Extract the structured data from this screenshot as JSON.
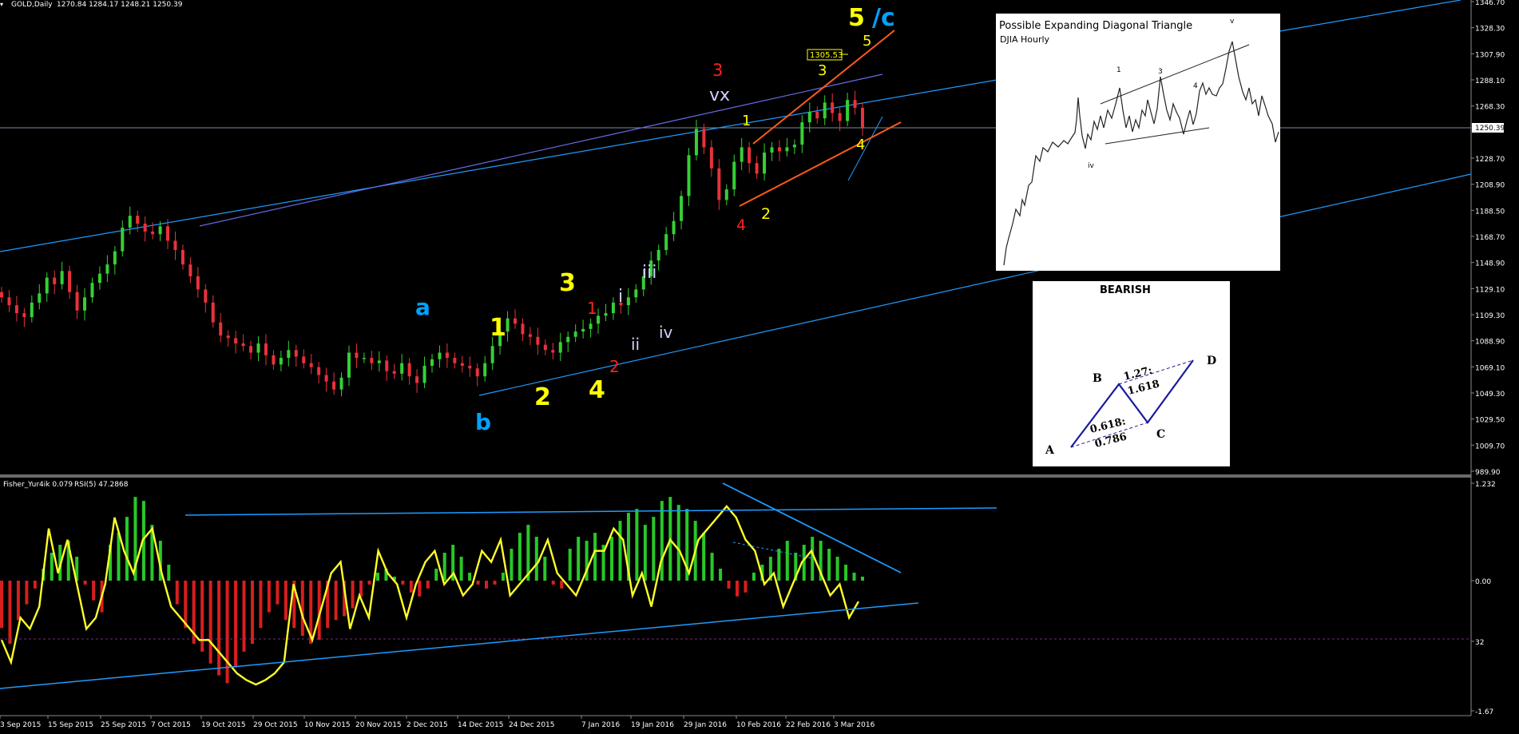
{
  "header": {
    "symbol": "GOLD,Daily",
    "ohlc": "1270.84 1284.17 1248.21 1250.39"
  },
  "sub_header": {
    "indicator": "Fisher_Yur4ik 0.079",
    "rsi": "RSI(5) 47.2868"
  },
  "price_axis": {
    "labels": [
      "1346.70",
      "1328.30",
      "1307.90",
      "1288.10",
      "1268.30",
      "1250.39",
      "1228.70",
      "1208.90",
      "1188.50",
      "1168.70",
      "1148.90",
      "1129.10",
      "1109.30",
      "1088.90",
      "1069.10",
      "1049.30",
      "1029.50",
      "1009.70",
      "989.90"
    ],
    "current": "1250.39"
  },
  "sub_axis": {
    "labels": [
      "1.232",
      "0.00",
      "32",
      "-1.67"
    ]
  },
  "date_axis": {
    "labels": [
      "3 Sep 2015",
      "15 Sep 2015",
      "25 Sep 2015",
      "7 Oct 2015",
      "19 Oct 2015",
      "29 Oct 2015",
      "10 Nov 2015",
      "20 Nov 2015",
      "2 Dec 2015",
      "14 Dec 2015",
      "24 Dec 2015",
      "7 Jan 2016",
      "19 Jan 2016",
      "29 Jan 2016",
      "10 Feb 2016",
      "22 Feb 2016",
      "3 Mar 2016"
    ]
  },
  "price_tag": "1305.53",
  "wave_labels": [
    {
      "text": "5",
      "color": "#ffff00"
    },
    {
      "text": "/c",
      "color": "#00a2ff"
    },
    {
      "text": "5",
      "color": "#ffff00"
    },
    {
      "text": "3",
      "color": "#ffff00"
    },
    {
      "text": "3",
      "color": "#ff2020"
    },
    {
      "text": "vx",
      "color": "#d0d0ff"
    },
    {
      "text": "1",
      "color": "#ffff00"
    },
    {
      "text": "4",
      "color": "#ffff00"
    },
    {
      "text": "2",
      "color": "#ffff00"
    },
    {
      "text": "4",
      "color": "#ff2020"
    },
    {
      "text": "iii",
      "color": "#d0d0ff"
    },
    {
      "text": "i",
      "color": "#d0d0ff"
    },
    {
      "text": "ii",
      "color": "#d0d0ff"
    },
    {
      "text": "iv",
      "color": "#d0d0ff"
    },
    {
      "text": "3",
      "color": "#ffff00"
    },
    {
      "text": "1",
      "color": "#ff2020"
    },
    {
      "text": "2",
      "color": "#ff2020"
    },
    {
      "text": "4",
      "color": "#ffff00"
    },
    {
      "text": "1",
      "color": "#ffff00"
    },
    {
      "text": "2",
      "color": "#ffff00"
    },
    {
      "text": "a",
      "color": "#00a2ff"
    },
    {
      "text": "b",
      "color": "#00a2ff"
    }
  ],
  "inset_diagonal": {
    "title": "Possible Expanding Diagonal Triangle",
    "subtitle": "DJIA Hourly"
  },
  "inset_bearish": {
    "title": "BEARISH",
    "points": [
      "A",
      "B",
      "C",
      "D"
    ],
    "ratio_ab": "0.618:",
    "ratio_ab2": "0.786",
    "ratio_cd": "1.27:",
    "ratio_cd2": "1.618"
  },
  "colors": {
    "background": "#000000",
    "bull": "#35d035",
    "bear": "#e8323c",
    "channel": "#1f9bff",
    "channel_purple": "#6a6ae8",
    "orange": "#ff5a1a",
    "fisher_pos": "#28c828",
    "fisher_neg": "#d81e1e",
    "rsi": "#ffff28"
  },
  "chart_data": [
    {
      "type": "candlestick",
      "title": "GOLD,Daily",
      "x": [
        "3 Sep 2015",
        "15 Sep 2015",
        "25 Sep 2015",
        "7 Oct 2015",
        "19 Oct 2015",
        "29 Oct 2015",
        "10 Nov 2015",
        "20 Nov 2015",
        "2 Dec 2015",
        "14 Dec 2015",
        "24 Dec 2015",
        "7 Jan 2016",
        "19 Jan 2016",
        "29 Jan 2016",
        "10 Feb 2016",
        "22 Feb 2016",
        "3 Mar 2016"
      ],
      "close_path": [
        1122,
        1116,
        1110,
        1107,
        1118,
        1125,
        1137,
        1132,
        1142,
        1126,
        1112,
        1122,
        1133,
        1140,
        1147,
        1157,
        1175,
        1184,
        1178,
        1172,
        1170,
        1176,
        1165,
        1158,
        1147,
        1138,
        1128,
        1118,
        1103,
        1093,
        1091,
        1087,
        1085,
        1080,
        1087,
        1078,
        1071,
        1076,
        1082,
        1077,
        1072,
        1069,
        1063,
        1058,
        1052,
        1061,
        1080,
        1076,
        1076,
        1072,
        1074,
        1066,
        1064,
        1072,
        1062,
        1057,
        1070,
        1075,
        1080,
        1076,
        1072,
        1070,
        1068,
        1062,
        1072,
        1085,
        1096,
        1106,
        1102,
        1094,
        1092,
        1086,
        1082,
        1080,
        1088,
        1092,
        1096,
        1098,
        1102,
        1108,
        1110,
        1118,
        1116,
        1122,
        1128,
        1138,
        1150,
        1158,
        1170,
        1180,
        1199,
        1230,
        1250,
        1236,
        1220,
        1196,
        1204,
        1225,
        1236,
        1224,
        1216,
        1232,
        1236,
        1233,
        1236,
        1238,
        1255,
        1263,
        1258,
        1270,
        1262,
        1256,
        1272,
        1266,
        1251
      ],
      "ylim": [
        989.9,
        1346.7
      ],
      "current_price": 1250.39
    },
    {
      "type": "bar",
      "title": "Fisher_Yur4ik 0.079",
      "series": [
        {
          "name": "Fisher_Yur4ik",
          "values": [
            -0.6,
            -0.8,
            -0.5,
            -0.3,
            -0.1,
            0.15,
            0.35,
            0.45,
            0.5,
            0.3,
            -0.05,
            -0.25,
            -0.4,
            0.45,
            0.6,
            0.8,
            1.05,
            1.0,
            0.7,
            0.5,
            0.2,
            -0.3,
            -0.6,
            -0.8,
            -0.9,
            -1.05,
            -1.2,
            -1.3,
            -1.1,
            -0.9,
            -0.8,
            -0.6,
            -0.4,
            -0.3,
            -0.5,
            -0.6,
            -0.7,
            -0.8,
            -0.75,
            -0.6,
            -0.5,
            -0.45,
            -0.35,
            -0.2,
            -0.05,
            0.1,
            0.15,
            0.05,
            -0.05,
            -0.15,
            -0.2,
            -0.1,
            0.15,
            0.35,
            0.45,
            0.3,
            0.1,
            -0.05,
            -0.1,
            -0.05,
            0.1,
            0.4,
            0.6,
            0.7,
            0.55,
            0.3,
            -0.05,
            -0.1,
            0.4,
            0.55,
            0.5,
            0.6,
            0.45,
            0.55,
            0.75,
            0.85,
            0.9,
            0.7,
            0.8,
            1.0,
            1.05,
            0.95,
            0.9,
            0.75,
            0.6,
            0.35,
            0.15,
            -0.1,
            -0.2,
            -0.15,
            0.1,
            0.2,
            0.3,
            0.4,
            0.5,
            0.35,
            0.45,
            0.55,
            0.5,
            0.4,
            0.3,
            0.2,
            0.1,
            0.05
          ]
        }
      ],
      "ylim": [
        -1.67,
        1.232
      ]
    },
    {
      "type": "line",
      "title": "RSI(5) 47.2868",
      "series": [
        {
          "name": "RSI(5)",
          "values": [
            30,
            20,
            40,
            35,
            45,
            80,
            60,
            75,
            55,
            35,
            40,
            55,
            85,
            70,
            60,
            75,
            80,
            60,
            45,
            40,
            35,
            30,
            30,
            25,
            20,
            15,
            12,
            10,
            12,
            15,
            20,
            55,
            40,
            30,
            45,
            60,
            65,
            35,
            50,
            40,
            70,
            60,
            55,
            40,
            55,
            65,
            70,
            55,
            60,
            50,
            55,
            70,
            65,
            75,
            50,
            55,
            60,
            65,
            75,
            60,
            55,
            50,
            60,
            70,
            70,
            80,
            75,
            50,
            60,
            45,
            65,
            75,
            70,
            60,
            75,
            80,
            85,
            90,
            85,
            75,
            70,
            55,
            60,
            45,
            55,
            65,
            70,
            60,
            50,
            55,
            40,
            47.2868
          ]
        }
      ],
      "ylim": [
        0,
        100
      ]
    }
  ]
}
